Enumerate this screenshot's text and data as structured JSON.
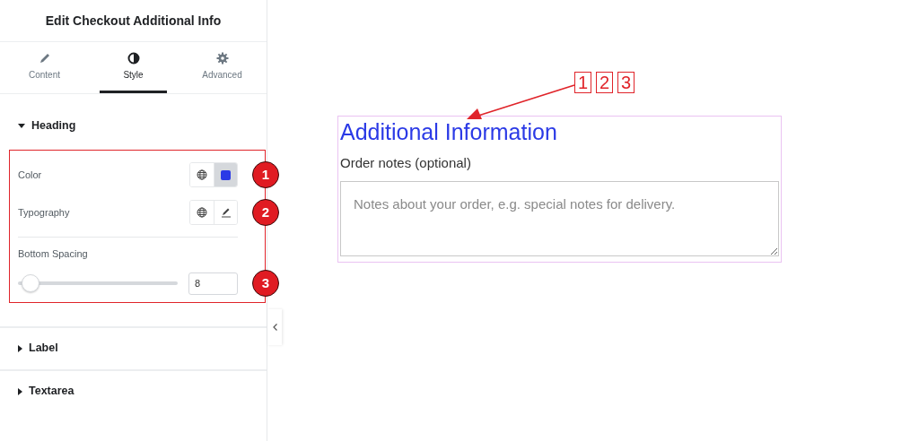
{
  "panel": {
    "title": "Edit Checkout Additional Info",
    "tabs": [
      {
        "label": "Content",
        "selected": false
      },
      {
        "label": "Style",
        "selected": true
      },
      {
        "label": "Advanced",
        "selected": false
      }
    ],
    "sections": [
      {
        "title": "Heading",
        "expanded": true,
        "controls": [
          {
            "kind": "color",
            "label": "Color",
            "color": "#2b3ae6",
            "badge": "1"
          },
          {
            "kind": "typography",
            "label": "Typography",
            "badge": "2"
          },
          {
            "kind": "slider",
            "label": "Bottom Spacing",
            "level": 0.08,
            "value": "8",
            "badge": "3"
          }
        ]
      },
      {
        "title": "Label",
        "expanded": false
      },
      {
        "title": "Textarea",
        "expanded": false
      }
    ]
  },
  "annotation": {
    "labels": [
      "1",
      "2",
      "3"
    ]
  },
  "preview": {
    "heading": "Additional Information",
    "label": "Order notes (optional)",
    "placeholder": "Notes about your order, e.g. special notes for delivery."
  }
}
